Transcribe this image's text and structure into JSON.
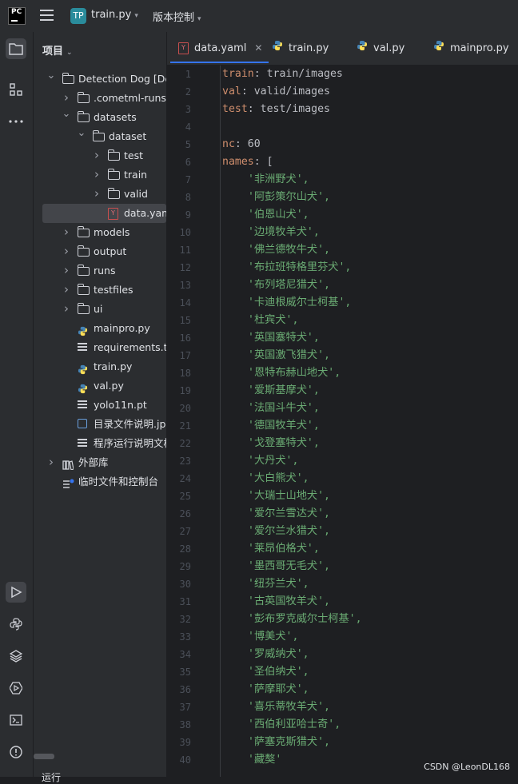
{
  "topbar": {
    "logo_text": "PC",
    "project_badge": "TP",
    "project_name": "train.py",
    "vcs_label": "版本控制"
  },
  "panel": {
    "title": "项目",
    "tree": [
      {
        "label": "Detection Dog [Det",
        "depth": 0,
        "kind": "folder",
        "expanded": true
      },
      {
        "label": ".cometml-runs",
        "depth": 1,
        "kind": "folder",
        "expanded": false
      },
      {
        "label": "datasets",
        "depth": 1,
        "kind": "folder",
        "expanded": true
      },
      {
        "label": "dataset",
        "depth": 2,
        "kind": "folder",
        "expanded": true
      },
      {
        "label": "test",
        "depth": 3,
        "kind": "folder",
        "expanded": false
      },
      {
        "label": "train",
        "depth": 3,
        "kind": "folder",
        "expanded": false
      },
      {
        "label": "valid",
        "depth": 3,
        "kind": "folder",
        "expanded": false
      },
      {
        "label": "data.yaml",
        "depth": 3,
        "kind": "yaml",
        "selected": true
      },
      {
        "label": "models",
        "depth": 1,
        "kind": "folder",
        "expanded": false
      },
      {
        "label": "output",
        "depth": 1,
        "kind": "folder",
        "expanded": false
      },
      {
        "label": "runs",
        "depth": 1,
        "kind": "folder",
        "expanded": false
      },
      {
        "label": "testfiles",
        "depth": 1,
        "kind": "folder",
        "expanded": false
      },
      {
        "label": "ui",
        "depth": 1,
        "kind": "folder",
        "expanded": false
      },
      {
        "label": "mainpro.py",
        "depth": 1,
        "kind": "py"
      },
      {
        "label": "requirements.txt",
        "depth": 1,
        "kind": "txt"
      },
      {
        "label": "train.py",
        "depth": 1,
        "kind": "py"
      },
      {
        "label": "val.py",
        "depth": 1,
        "kind": "py"
      },
      {
        "label": "yolo11n.pt",
        "depth": 1,
        "kind": "txt"
      },
      {
        "label": "目录文件说明.jpg",
        "depth": 1,
        "kind": "img"
      },
      {
        "label": "程序运行说明文档",
        "depth": 1,
        "kind": "txt"
      },
      {
        "label": "外部库",
        "depth": 0,
        "kind": "lib",
        "expanded": false
      },
      {
        "label": "临时文件和控制台",
        "depth": 0,
        "kind": "scratch"
      }
    ]
  },
  "bottom": {
    "label": "运行"
  },
  "tabs": [
    {
      "label": "data.yaml",
      "kind": "yaml",
      "active": true
    },
    {
      "label": "train.py",
      "kind": "py"
    },
    {
      "label": "val.py",
      "kind": "py"
    },
    {
      "label": "mainpro.py",
      "kind": "py"
    }
  ],
  "editor": {
    "lines": [
      {
        "n": "1",
        "key": "train",
        "value": "train/images"
      },
      {
        "n": "2",
        "key": "val",
        "value": "valid/images"
      },
      {
        "n": "3",
        "key": "test",
        "value": "test/images"
      },
      {
        "n": "4"
      },
      {
        "n": "5",
        "key": "nc",
        "value": "60"
      },
      {
        "n": "6",
        "key": "names",
        "value": "["
      },
      {
        "n": "7",
        "str": "'非洲野犬',"
      },
      {
        "n": "8",
        "str": "'阿彭策尔山犬',"
      },
      {
        "n": "9",
        "str": "'伯恩山犬',"
      },
      {
        "n": "10",
        "str": "'边境牧羊犬',"
      },
      {
        "n": "11",
        "str": "'佛兰德牧牛犬',"
      },
      {
        "n": "12",
        "str": "'布拉班特格里芬犬',"
      },
      {
        "n": "13",
        "str": "'布列塔尼猎犬',"
      },
      {
        "n": "14",
        "str": "'卡迪根威尔士柯基',"
      },
      {
        "n": "15",
        "str": "'杜宾犬',"
      },
      {
        "n": "16",
        "str": "'英国塞特犬',"
      },
      {
        "n": "17",
        "str": "'英国激飞猎犬',"
      },
      {
        "n": "18",
        "str": "'恩特布赫山地犬',"
      },
      {
        "n": "19",
        "str": "'爱斯基摩犬',"
      },
      {
        "n": "20",
        "str": "'法国斗牛犬',"
      },
      {
        "n": "21",
        "str": "'德国牧羊犬',"
      },
      {
        "n": "22",
        "str": "'戈登塞特犬',"
      },
      {
        "n": "23",
        "str": "'大丹犬',"
      },
      {
        "n": "24",
        "str": "'大白熊犬',"
      },
      {
        "n": "25",
        "str": "'大瑞士山地犬',"
      },
      {
        "n": "26",
        "str": "'爱尔兰雪达犬',"
      },
      {
        "n": "27",
        "str": "'爱尔兰水猎犬',"
      },
      {
        "n": "28",
        "str": "'莱昂伯格犬',"
      },
      {
        "n": "29",
        "str": "'墨西哥无毛犬',"
      },
      {
        "n": "30",
        "str": "'纽芬兰犬',"
      },
      {
        "n": "31",
        "str": "'古英国牧羊犬',"
      },
      {
        "n": "32",
        "str": "'彭布罗克威尔士柯基',"
      },
      {
        "n": "33",
        "str": "'博美犬',"
      },
      {
        "n": "34",
        "str": "'罗威纳犬',"
      },
      {
        "n": "35",
        "str": "'圣伯纳犬',"
      },
      {
        "n": "36",
        "str": "'萨摩耶犬',"
      },
      {
        "n": "37",
        "str": "'喜乐蒂牧羊犬',"
      },
      {
        "n": "38",
        "str": "'西伯利亚哈士奇',"
      },
      {
        "n": "39",
        "str": "'萨塞克斯猎犬',"
      },
      {
        "n": "40",
        "str": "'藏獒'"
      }
    ]
  },
  "watermark": "CSDN @LeonDL168",
  "colors": {
    "accent": "#3574f0",
    "string": "#6aab73",
    "keyword": "#cf8e6d"
  }
}
